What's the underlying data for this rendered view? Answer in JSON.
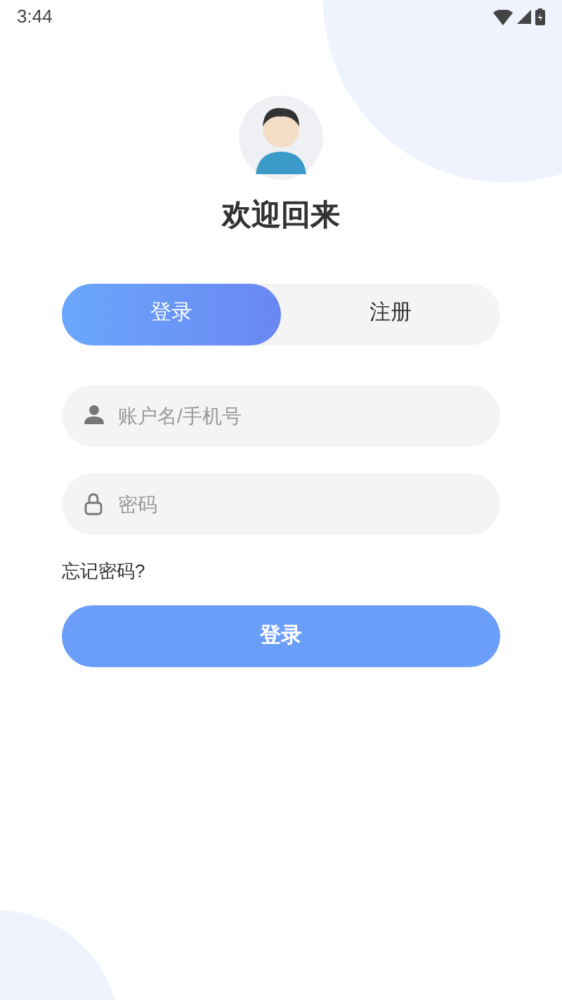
{
  "status_bar": {
    "time": "3:44"
  },
  "title": "欢迎回来",
  "tabs": [
    {
      "label": "登录",
      "selected": true
    },
    {
      "label": "注册",
      "selected": false
    }
  ],
  "fields": [
    {
      "kind": "user",
      "placeholder": "账户名/手机号"
    },
    {
      "kind": "password",
      "placeholder": "密码"
    }
  ],
  "forgot_link": "忘记密码?",
  "submit_button": "登录"
}
